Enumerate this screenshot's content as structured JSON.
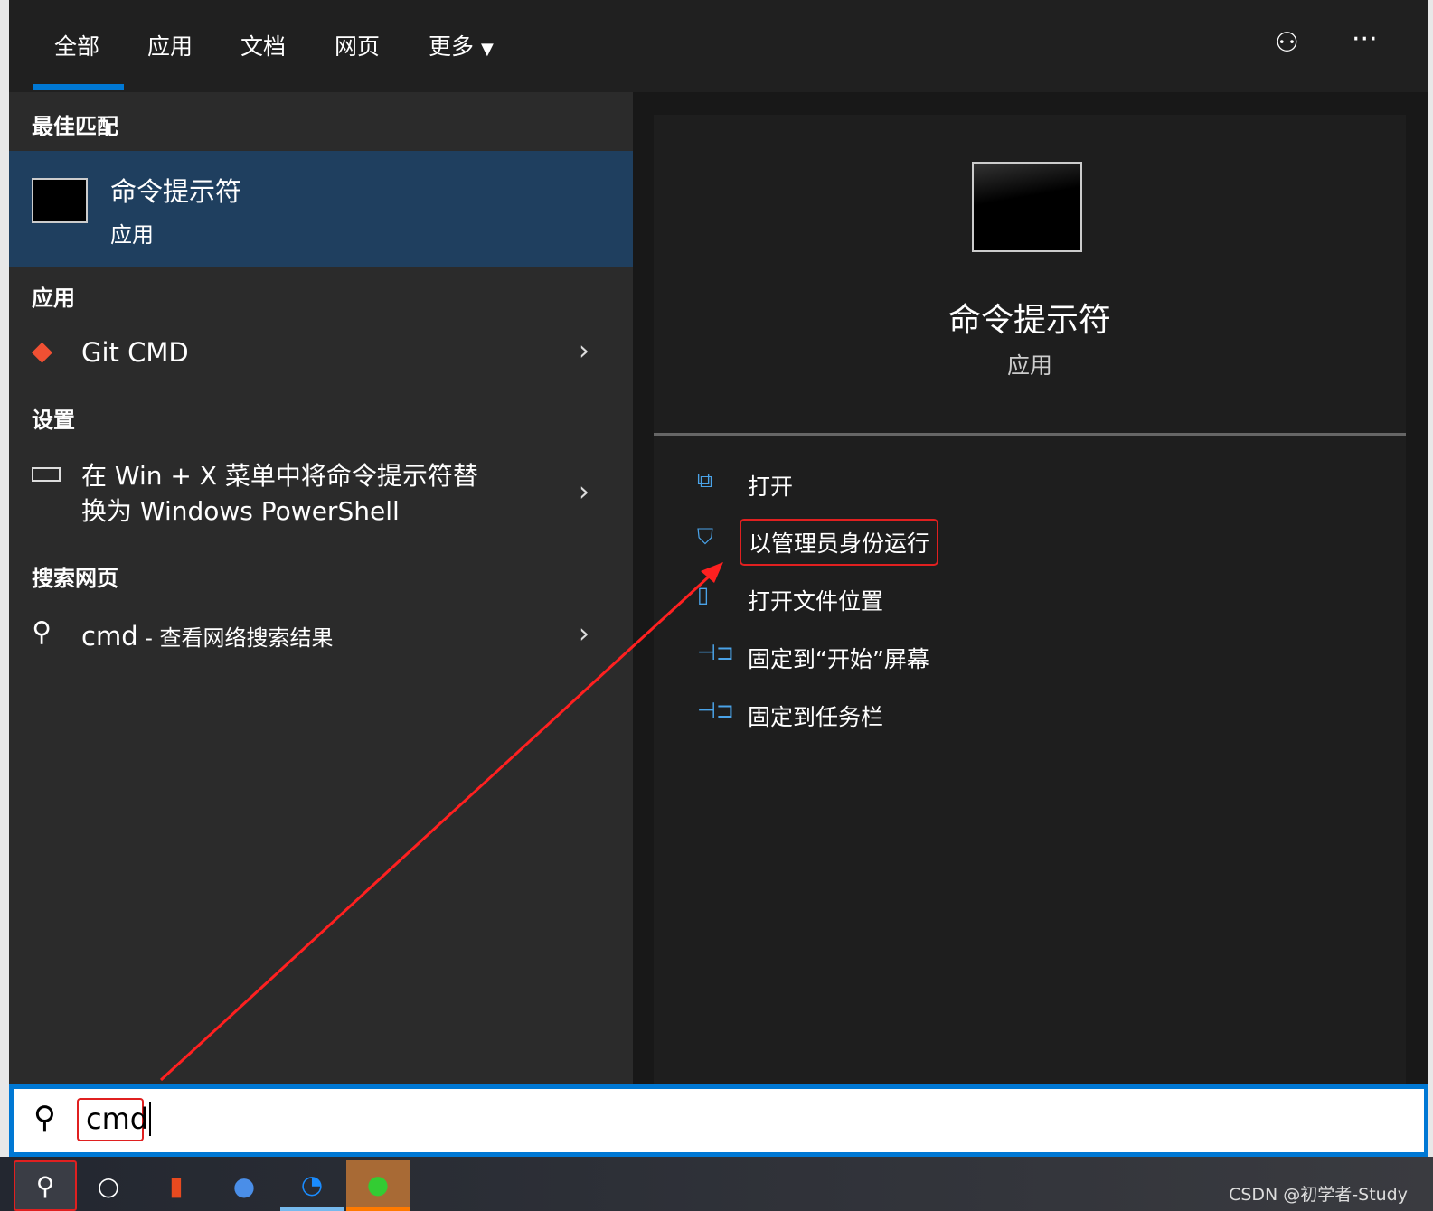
{
  "tabs": [
    "全部",
    "应用",
    "文档",
    "网页",
    "更多"
  ],
  "left": {
    "best_match_header": "最佳匹配",
    "best": {
      "title": "命令提示符",
      "subtitle": "应用"
    },
    "apps_header": "应用",
    "git": {
      "title": "Git CMD"
    },
    "settings_header": "设置",
    "setting": {
      "line1": "在 Win + X 菜单中将命令提示符替",
      "line2": "换为 Windows PowerShell"
    },
    "web_header": "搜索网页",
    "web": {
      "query": "cmd",
      "suffix": " - 查看网络搜索结果"
    }
  },
  "right": {
    "title": "命令提示符",
    "subtitle": "应用",
    "actions": [
      {
        "label": "打开",
        "icon": "open-icon"
      },
      {
        "label": "以管理员身份运行",
        "icon": "shield-icon"
      },
      {
        "label": "打开文件位置",
        "icon": "folder-icon"
      },
      {
        "label": "固定到“开始”屏幕",
        "icon": "pin-icon"
      },
      {
        "label": "固定到任务栏",
        "icon": "pin-icon"
      }
    ]
  },
  "search": {
    "value": "cmd"
  },
  "watermark": "CSDN @初学者-Study",
  "colors": {
    "accent": "#0078d4",
    "highlight": "#e02020",
    "selected": "#1f3f5f"
  }
}
